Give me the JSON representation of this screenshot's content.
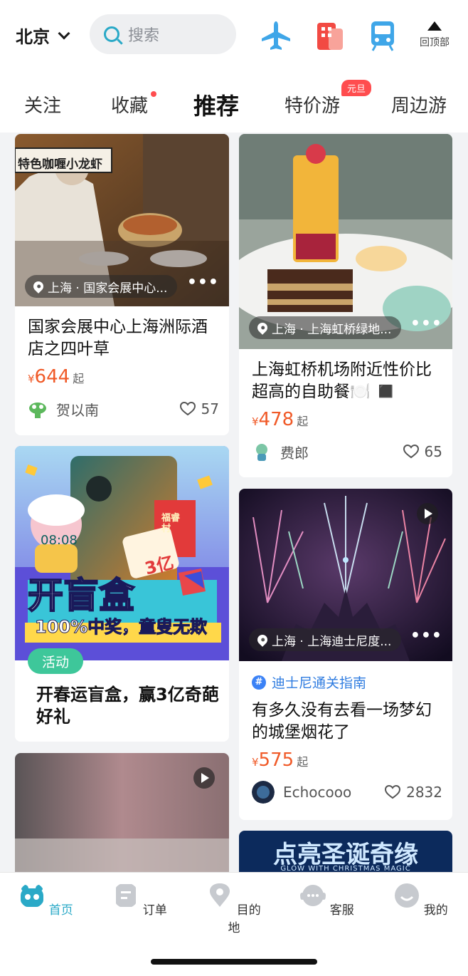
{
  "header": {
    "city": "北京",
    "search_placeholder": "搜索",
    "icons": [
      "plane-icon",
      "hotel-icon",
      "train-icon"
    ],
    "back_to_top": "回顶部"
  },
  "tabs": [
    {
      "label": "关注"
    },
    {
      "label": "收藏",
      "dot": true
    },
    {
      "label": "推荐",
      "active": true
    },
    {
      "label": "特价游",
      "badge": "元旦"
    },
    {
      "label": "周边游"
    }
  ],
  "cards": {
    "c1": {
      "photo_sign": "特色咖喱小龙虾",
      "location": "上海 · 国家会展中心...",
      "title": "国家会展中心上海洲际酒店之四叶草",
      "currency": "¥",
      "price": "644",
      "price_suffix": "起",
      "author": "贺以南",
      "likes": "57"
    },
    "c2": {
      "location": "上海 · 上海虹桥绿地...",
      "title": "上海虹桥机场附近性价比超高的自助餐🍽️ ◼️",
      "currency": "¥",
      "price": "478",
      "price_suffix": "起",
      "author": "费郎",
      "likes": "65"
    },
    "c3": {
      "phone_time": "08:08",
      "banner_title": "开盲盒",
      "banner_subtitle": "100%中奖，童叟无欺",
      "amount": "3亿",
      "red_packet": "福睿村",
      "tag": "活动",
      "title": "开春运盲盒，赢3亿奇葩好礼"
    },
    "c4": {
      "location": "上海 · 上海迪士尼度...",
      "topic": "迪士尼通关指南",
      "title": "有多久没有去看一场梦幻的城堡烟花了",
      "currency": "¥",
      "price": "575",
      "price_suffix": "起",
      "author": "Echocooo",
      "likes": "2832"
    },
    "c6": {
      "banner_title": "点亮圣诞奇缘",
      "banner_subtitle": "GLOW WITH CHRISTMAS MAGIC"
    }
  },
  "bottom_nav": [
    {
      "label": "首页",
      "active": true,
      "icon": "home-icon"
    },
    {
      "label": "订单",
      "icon": "order-icon"
    },
    {
      "label": "目的地",
      "icon": "destination-icon"
    },
    {
      "label": "客服",
      "icon": "customer-service-icon"
    },
    {
      "label": "我的",
      "icon": "profile-icon"
    }
  ],
  "colors": {
    "accent": "#2aa9c7",
    "price": "#f05a28",
    "tab_highlight": "#ffe817",
    "badge": "#ff4d4f",
    "activity_tag": "#3ec79a",
    "topic": "#2f7ce0"
  }
}
